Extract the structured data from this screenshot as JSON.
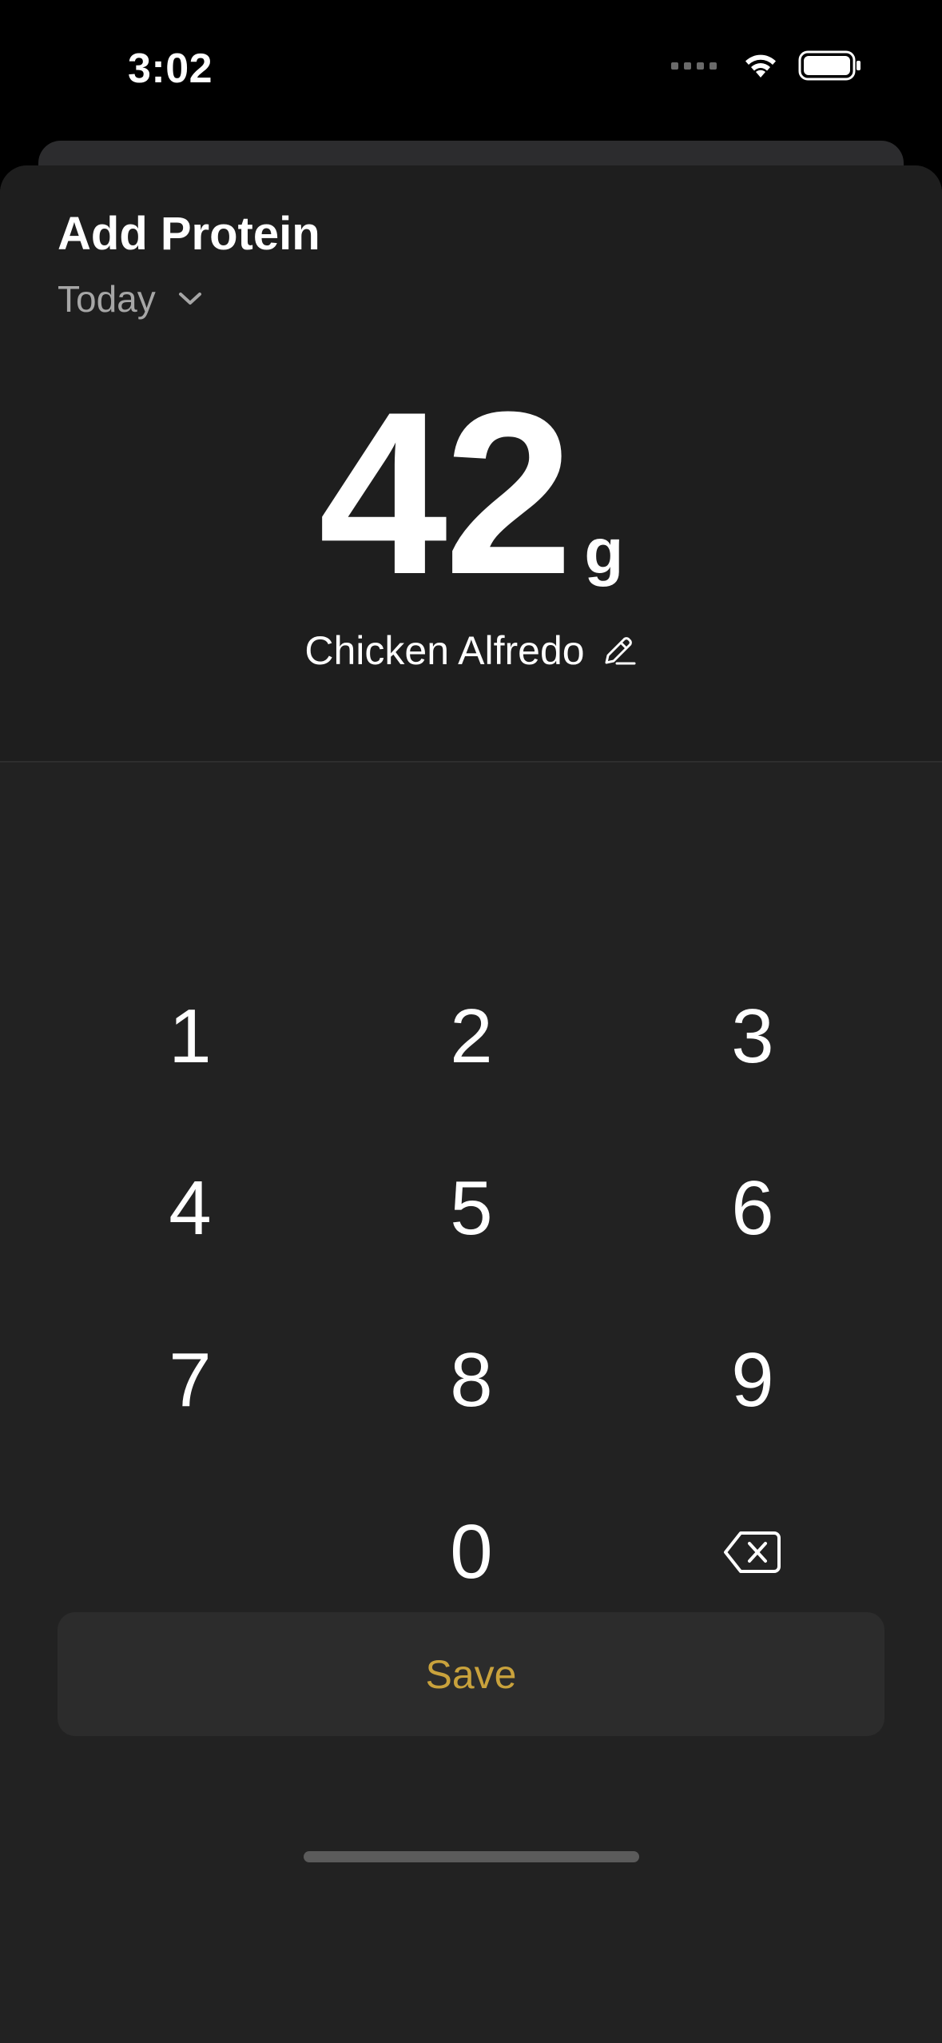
{
  "status_bar": {
    "time": "3:02"
  },
  "sheet": {
    "title": "Add Protein",
    "date_selector": {
      "label": "Today"
    },
    "amount": {
      "value": "42",
      "unit": "g"
    },
    "food_name": "Chicken Alfredo"
  },
  "keypad": {
    "keys": [
      "1",
      "2",
      "3",
      "4",
      "5",
      "6",
      "7",
      "8",
      "9",
      "0"
    ],
    "delete_icon": "backspace-icon"
  },
  "save_button": {
    "label": "Save"
  },
  "colors": {
    "accent": "#c9a23c",
    "sheet_background": "#222222",
    "header_background": "#1e1e1e",
    "secondary_text": "#a6a6a6"
  },
  "icons": [
    "wifi-icon",
    "battery-icon",
    "chevron-down-icon",
    "pencil-icon",
    "backspace-icon"
  ]
}
